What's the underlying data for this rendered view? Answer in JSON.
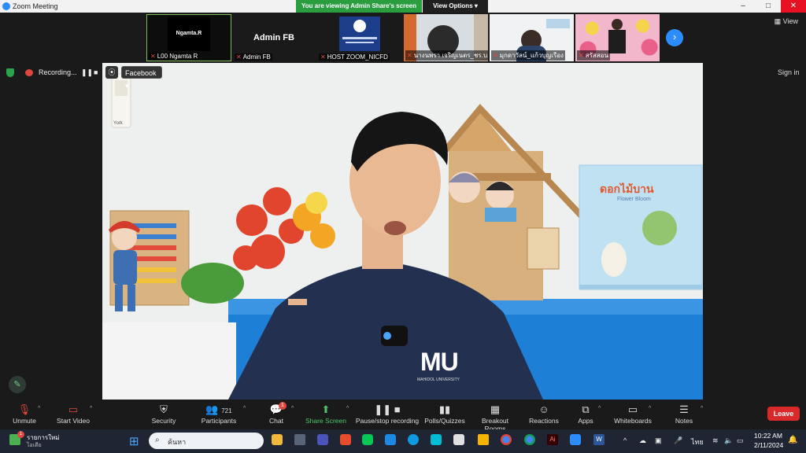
{
  "window": {
    "title": "Zoom Meeting"
  },
  "share_banner": {
    "text": "You are viewing Admin Share's screen",
    "view_options": "View Options"
  },
  "thumbnails": [
    {
      "name": "L00 Ngamta R",
      "tile_text": "Ngamta.R"
    },
    {
      "name": "Admin FB",
      "tile_text": "Admin FB"
    },
    {
      "name": "HOST ZOOM_NICFD",
      "tile_text": ""
    },
    {
      "name": "นางนพรา เจริญเนตร_ชร.บ...",
      "tile_text": ""
    },
    {
      "name": "มุกดาวัลน์_แก้วบุญเรือง",
      "tile_text": ""
    },
    {
      "name": "สรัสสอน",
      "tile_text": ""
    }
  ],
  "view_label": "View",
  "recording": {
    "label": "Recording...",
    "pause_icon": "pause-icon",
    "stop_icon": "stop-icon"
  },
  "facebook_label": "Facebook",
  "sign_in": "Sign in",
  "video": {
    "shirt_text": "MU",
    "shirt_subtext": "MAHIDOL UNIVERSITY",
    "book_title": "ดอกไม้บาน",
    "book_subtitle": "Flower Bloom",
    "switch_label": "York"
  },
  "toolbar": {
    "unmute": "Unmute",
    "start_video": "Start Video",
    "security": "Security",
    "participants": "Participants",
    "participants_count": "721",
    "chat": "Chat",
    "chat_badge": "1",
    "share_screen": "Share Screen",
    "pause_recording": "Pause/stop recording",
    "polls": "Polls/Quizzes",
    "breakout": "Breakout Rooms",
    "reactions": "Reactions",
    "apps": "Apps",
    "whiteboards": "Whiteboards",
    "notes": "Notes",
    "leave": "Leave"
  },
  "taskbar": {
    "news_title": "รายการใหม่",
    "news_sub": "ไอเดีย",
    "news_badge": "1",
    "search_placeholder": "ค้นหา",
    "lang": "ไทย",
    "time": "10:22 AM",
    "date": "2/11/2024"
  },
  "colors": {
    "zoom_blue": "#2d8cff",
    "share_green": "#2aa34a",
    "leave_red": "#d9292b",
    "mute_red": "#e0483f"
  }
}
